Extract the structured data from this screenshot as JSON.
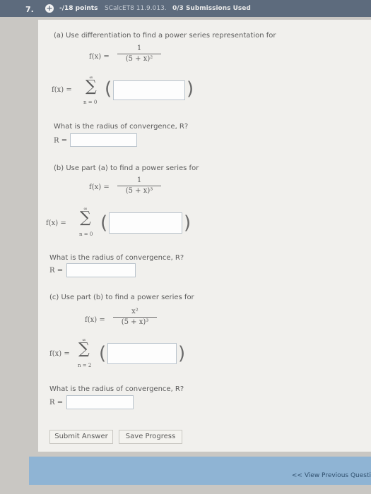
{
  "header": {
    "question_number": "7.",
    "points": "-/18 points",
    "reference": "SCalcET8 11.9.013.",
    "submissions": "0/3 Submissions Used"
  },
  "part_a": {
    "prompt": "(a) Use differentiation to find a power series representation for",
    "fx": "f(x) =",
    "numerator": "1",
    "denominator": "(5 + x)²",
    "sum_lhs": "f(x) =",
    "upper": "∞",
    "lower": "n = 0",
    "radius_q": "What is the radius of convergence, R?",
    "r_label": "R ="
  },
  "part_b": {
    "prompt": "(b) Use part (a) to find a power series for",
    "fx": "f(x) =",
    "numerator": "1",
    "denominator": "(5 + x)³",
    "sum_lhs": "f(x) =",
    "upper": "∞",
    "lower": "n = 0",
    "radius_q": "What is the radius of convergence, R?",
    "r_label": "R ="
  },
  "part_c": {
    "prompt": "(c) Use part (b) to find a power series for",
    "fx": "f(x) =",
    "numerator": "x²",
    "denominator": "(5 + x)³",
    "sum_lhs": "f(x) =",
    "upper": "∞",
    "lower": "n = 2",
    "radius_q": "What is the radius of convergence, R?",
    "r_label": "R ="
  },
  "buttons": {
    "submit": "Submit Answer",
    "save": "Save Progress"
  },
  "footer": {
    "prev": "<< View Previous Questi"
  }
}
